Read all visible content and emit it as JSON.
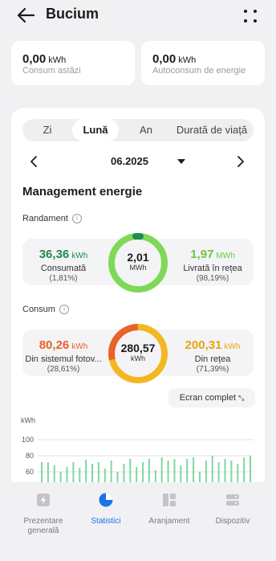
{
  "header": {
    "title": "Bucium"
  },
  "summary": [
    {
      "value": "0,00",
      "unit": "kWh",
      "label": "Consum astăzi"
    },
    {
      "value": "0,00",
      "unit": "kWh",
      "label": "Autoconsum de energie"
    }
  ],
  "tabs": [
    {
      "label": "Zi"
    },
    {
      "label": "Lună"
    },
    {
      "label": "An"
    },
    {
      "label": "Durată de viață"
    }
  ],
  "period": {
    "date": "06.2025"
  },
  "section_title": "Management energie",
  "efficiency": {
    "title": "Randament",
    "center_value": "2,01",
    "center_unit": "MWh",
    "left": {
      "value": "36,36",
      "unit": "kWh",
      "label": "Consumată",
      "pct": "(1,81%)"
    },
    "right": {
      "value": "1,97",
      "unit": "MWh",
      "label": "Livrată în rețea",
      "pct": "(98,19%)"
    },
    "colors": {
      "consumed": "#1f8a4c",
      "delivered": "#7ed957"
    },
    "consumed_fraction": 0.0181
  },
  "consumption": {
    "title": "Consum",
    "center_value": "280,57",
    "center_unit": "kWh",
    "left": {
      "value": "80,26",
      "unit": "kWh",
      "label": "Din sistemul fotov...",
      "pct": "(28,61%)"
    },
    "right": {
      "value": "200,31",
      "unit": "kWh",
      "label": "Din rețea",
      "pct": "(71,39%)"
    },
    "colors": {
      "pv": "#e8622a",
      "grid": "#f2b722"
    },
    "pv_fraction": 0.2861
  },
  "fullscreen_label": "Ecran complet",
  "chart_data": {
    "type": "bar",
    "ylabel": "kWh",
    "yticks": [
      "100",
      "80",
      "60"
    ],
    "ylim": [
      45,
      105
    ],
    "values": [
      72,
      72,
      68,
      60,
      66,
      72,
      65,
      75,
      70,
      72,
      64,
      74,
      60,
      70,
      76,
      66,
      72,
      76,
      62,
      78,
      74,
      76,
      68,
      76,
      78,
      60,
      74,
      80,
      72,
      76,
      74,
      70,
      78,
      80
    ],
    "color": "#7ed8a0"
  },
  "bottom_nav": [
    {
      "label": "Prezentare generală",
      "icon": "overview-icon"
    },
    {
      "label": "Statistici",
      "icon": "statistics-icon",
      "active": true
    },
    {
      "label": "Aranjament",
      "icon": "layout-icon"
    },
    {
      "label": "Dispozitiv",
      "icon": "device-icon"
    }
  ]
}
